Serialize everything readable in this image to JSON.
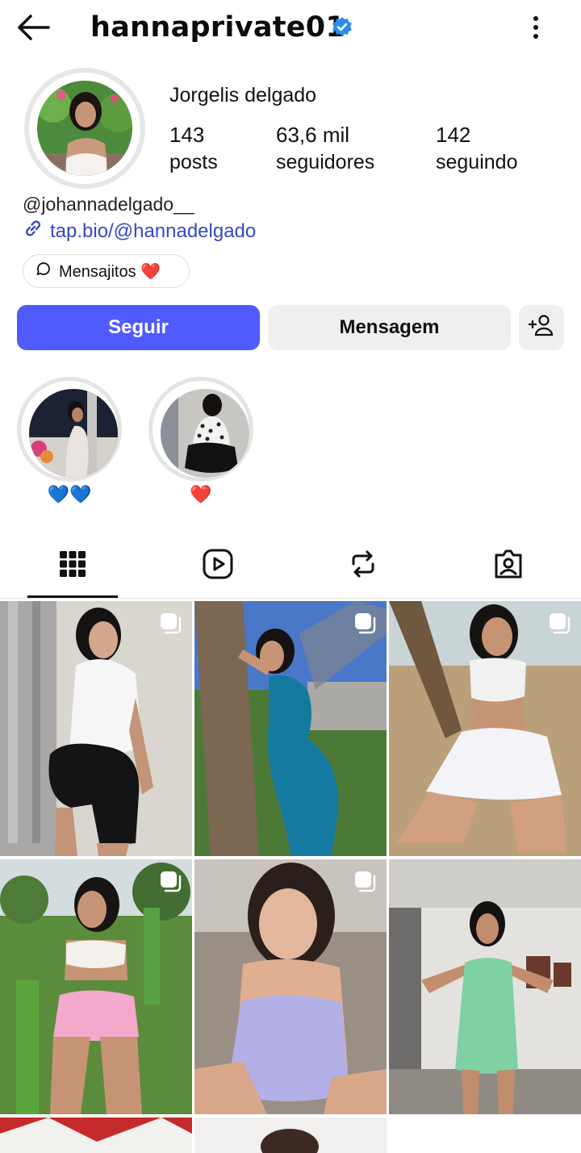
{
  "header": {
    "username": "hannaprivate01",
    "verified_icon": "verified-badge-icon",
    "back_icon": "arrow-left-icon",
    "menu_icon": "more-vertical-icon"
  },
  "profile": {
    "full_name": "Jorgelis delgado",
    "stats": {
      "posts_value": "143",
      "posts_label": "posts",
      "followers_value": "63,6 mil",
      "followers_label": "seguidores",
      "following_value": "142",
      "following_label": "seguindo"
    },
    "threads_handle": "@johannadelgado__",
    "link_text": "tap.bio/@hannadelgado",
    "chat_chip": "Mensajitos ❤️"
  },
  "actions": {
    "follow": "Seguir",
    "message": "Mensagem",
    "add_user_icon": "person-add-icon"
  },
  "highlights": [
    {
      "label": "💙💙"
    },
    {
      "label": "❤️"
    }
  ],
  "tabs": [
    {
      "icon": "grid-icon",
      "active": true
    },
    {
      "icon": "reels-icon",
      "active": false
    },
    {
      "icon": "reposts-icon",
      "active": false
    },
    {
      "icon": "tagged-icon",
      "active": false
    }
  ],
  "colors": {
    "accent": "#4f5bff",
    "link": "#3747c6",
    "verified": "#2a8cf0"
  }
}
